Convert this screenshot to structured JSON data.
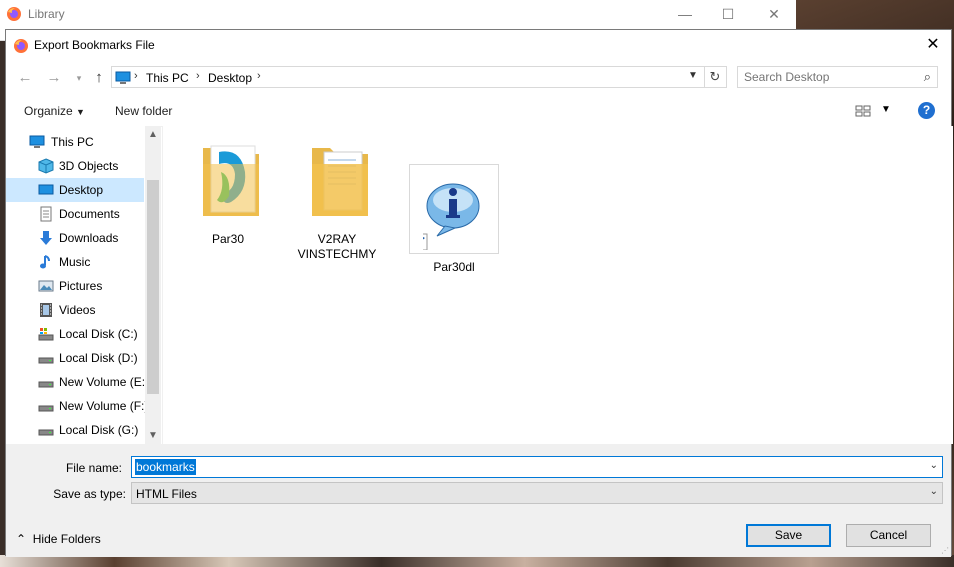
{
  "library": {
    "title": "Library"
  },
  "dialog": {
    "title": "Export Bookmarks File",
    "close_label": "✕"
  },
  "address": {
    "crumbs": [
      "This PC",
      "Desktop"
    ]
  },
  "search": {
    "placeholder": "Search Desktop"
  },
  "toolbar": {
    "organize": "Organize",
    "new_folder": "New folder",
    "help": "?"
  },
  "nav": {
    "items": [
      {
        "label": "This PC",
        "icon": "computer-icon"
      },
      {
        "label": "3D Objects",
        "icon": "cube-icon"
      },
      {
        "label": "Desktop",
        "icon": "desktop-icon",
        "selected": true
      },
      {
        "label": "Documents",
        "icon": "document-icon"
      },
      {
        "label": "Downloads",
        "icon": "download-icon"
      },
      {
        "label": "Music",
        "icon": "music-icon"
      },
      {
        "label": "Pictures",
        "icon": "picture-icon"
      },
      {
        "label": "Videos",
        "icon": "video-icon"
      },
      {
        "label": "Local Disk (C:)",
        "icon": "system-drive-icon"
      },
      {
        "label": "Local Disk (D:)",
        "icon": "drive-icon"
      },
      {
        "label": "New Volume (E:)",
        "icon": "drive-icon"
      },
      {
        "label": "New Volume (F:)",
        "icon": "drive-icon"
      },
      {
        "label": "Local Disk (G:)",
        "icon": "drive-icon"
      }
    ]
  },
  "files": [
    {
      "label": "Par30",
      "icon": "folder-with-logo-icon"
    },
    {
      "label": "V2RAY VINSTECHMY",
      "icon": "folder-icon"
    },
    {
      "label": "Par30dl",
      "icon": "info-shortcut-icon",
      "selected": true
    }
  ],
  "form": {
    "file_name_label": "File name:",
    "file_name_value": "bookmarks",
    "save_type_label": "Save as type:",
    "save_type_value": "HTML Files",
    "hide_folders": "Hide Folders",
    "save": "Save",
    "cancel": "Cancel"
  },
  "colors": {
    "accent": "#0078d7",
    "selected_bg": "#cce8ff",
    "folder": "#f2c14e"
  }
}
